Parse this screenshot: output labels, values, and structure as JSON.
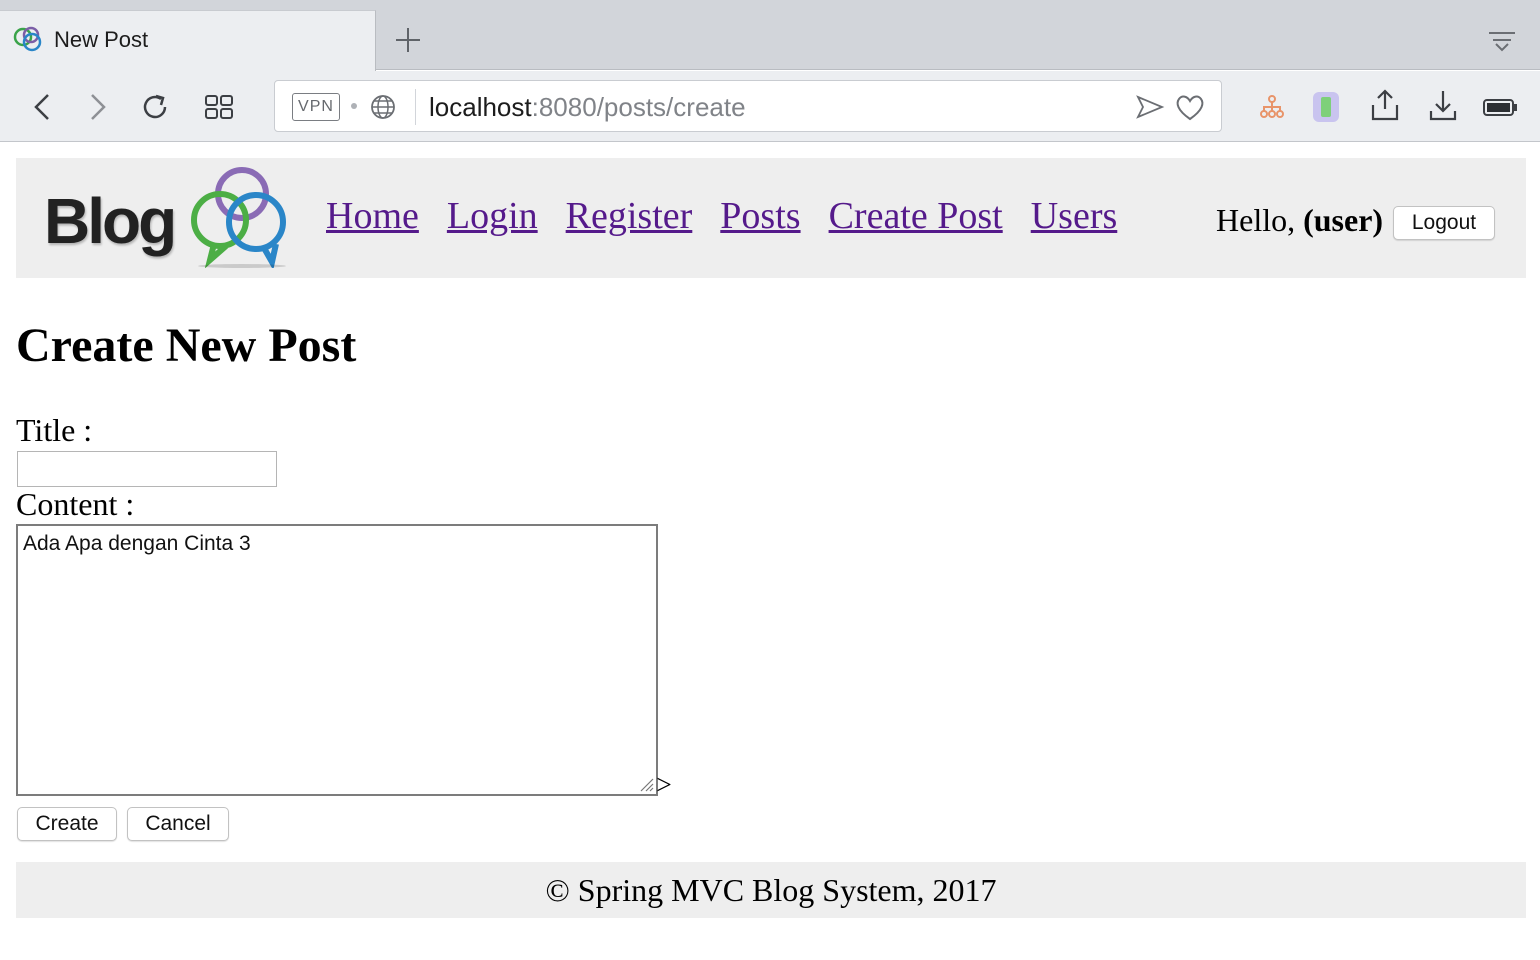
{
  "browser": {
    "tab_title": "New Post",
    "url_host": "localhost",
    "url_rest": ":8080/posts/create",
    "vpn_label": "VPN",
    "icons": {
      "back": "back-icon",
      "forward": "forward-icon",
      "reload": "reload-icon",
      "speed_dial": "grid-icon",
      "send": "send-icon",
      "bookmark": "heart-icon",
      "extension_1": "sitemap-icon",
      "extension_2": "brackets-icon",
      "share": "share-icon",
      "download": "download-icon",
      "battery": "battery-icon"
    }
  },
  "header": {
    "logo_text": "Blog",
    "nav": [
      "Home",
      "Login",
      "Register",
      "Posts",
      "Create Post",
      "Users"
    ],
    "hello_prefix": "Hello, ",
    "username": "(user)",
    "logout_label": "Logout"
  },
  "main": {
    "heading": "Create New Post",
    "title_label": "Title :",
    "title_value": "",
    "content_label": "Content :",
    "content_value": "Ada Apa dengan Cinta 3",
    "stray_text": ">",
    "create_label": "Create",
    "cancel_label": "Cancel"
  },
  "footer": {
    "text": "© Spring MVC Blog System, 2017"
  },
  "colors": {
    "link": "#551a8b",
    "header_bg": "#eeeeee",
    "chrome_bg": "#eceef1"
  }
}
